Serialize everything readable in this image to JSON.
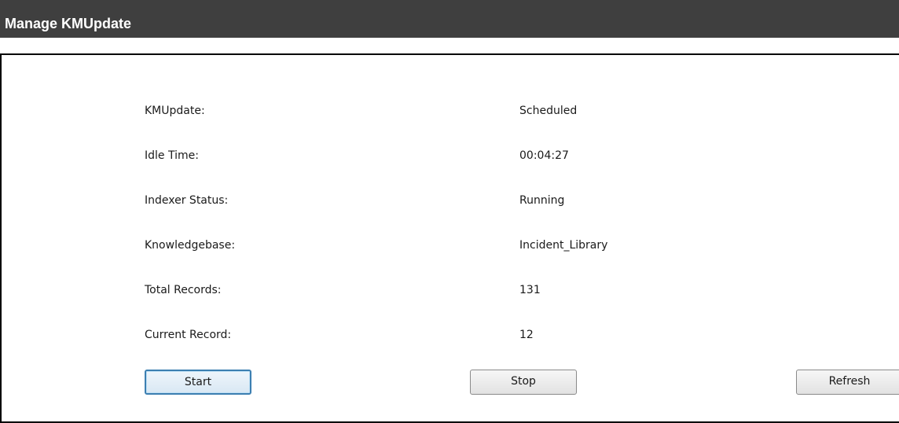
{
  "header": {
    "title": "Manage KMUpdate"
  },
  "fields": [
    {
      "label": "KMUpdate:",
      "value": "Scheduled"
    },
    {
      "label": "Idle Time:",
      "value": "00:04:27"
    },
    {
      "label": "Indexer Status:",
      "value": "Running"
    },
    {
      "label": "Knowledgebase:",
      "value": "Incident_Library"
    },
    {
      "label": "Total Records:",
      "value": "131"
    },
    {
      "label": "Current Record:",
      "value": "12"
    }
  ],
  "buttons": {
    "start": "Start",
    "stop": "Stop",
    "refresh": "Refresh"
  },
  "colors": {
    "header_bg": "#3f3f3f",
    "focus_border": "#3c7fb1"
  }
}
